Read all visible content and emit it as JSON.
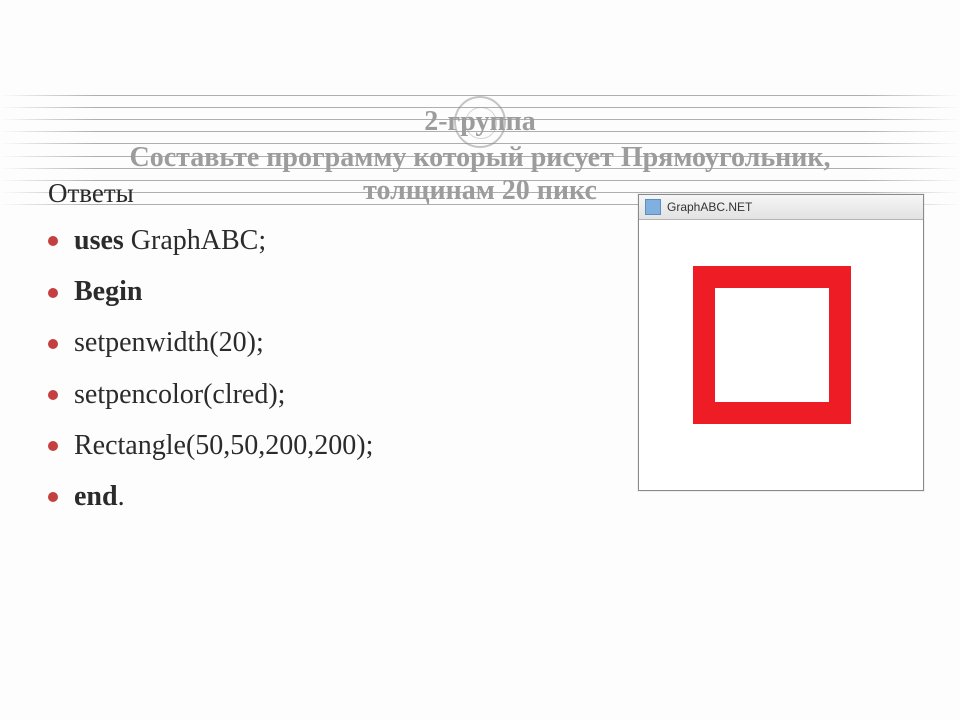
{
  "heading": {
    "group_label": "2-группа",
    "task_line1": "Составьте программу который рисует Прямоугольник,",
    "task_line2": "толщинам  20 пикс"
  },
  "answers_label": "Ответы",
  "code_lines": [
    {
      "kw": "uses",
      "rest": " GraphABC;"
    },
    {
      "kw": "Begin",
      "rest": ""
    },
    {
      "kw": "",
      "rest": "setpenwidth(20);"
    },
    {
      "kw": "",
      "rest": "   setpencolor(clred);"
    },
    {
      "kw": "",
      "rest": "Rectangle(50,50,200,200);"
    },
    {
      "kw": "end",
      "rest": "."
    }
  ],
  "window": {
    "title": "GraphABC.NET"
  },
  "colors": {
    "bullet": "#c43f3f",
    "rect_stroke": "#ee1c25",
    "heading_gray": "#9c9c9c"
  }
}
